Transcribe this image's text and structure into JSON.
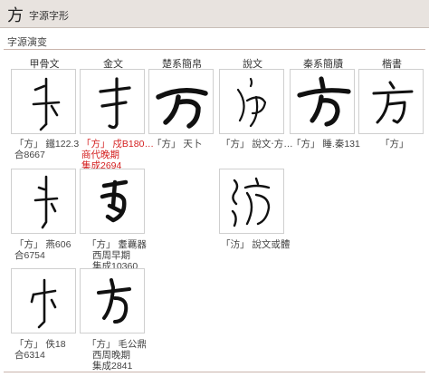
{
  "header": {
    "char": "方",
    "title": "字源字形"
  },
  "section": {
    "title": "字源演变"
  },
  "columns": [
    "甲骨文",
    "金文",
    "楚系簡帛",
    "說文",
    "秦系簡牘",
    "楷書"
  ],
  "cells": [
    {
      "id": "c1",
      "caption": [
        "「方」 鐵122.3",
        "合8667"
      ],
      "red": false
    },
    {
      "id": "c2",
      "caption": [
        "「方」 戍B180…",
        "商代晚期",
        "集成2694"
      ],
      "red": true
    },
    {
      "id": "c3",
      "caption": [
        "「方」 天卜"
      ],
      "red": false
    },
    {
      "id": "c4",
      "caption": [
        "「方」 說文‧方…"
      ],
      "red": false
    },
    {
      "id": "c5",
      "caption": [
        "「方」 睡.秦131"
      ],
      "red": false
    },
    {
      "id": "c6",
      "caption": [
        "「方」"
      ],
      "red": false
    },
    {
      "id": "c7",
      "caption": [
        "「方」 燕606",
        "合6754"
      ],
      "red": false
    },
    {
      "id": "c8",
      "caption": [
        "「方」 耋覊器",
        "西周早期",
        "集成10360"
      ],
      "red": false
    },
    {
      "id": "c9",
      "caption": [
        "「汸」 說文或體"
      ],
      "red": false
    },
    {
      "id": "c10",
      "caption": [
        "「方」 佚18",
        "合6314"
      ],
      "red": false
    },
    {
      "id": "c11",
      "caption": [
        "「方」 毛公鼎",
        "西周晚期",
        "集成2841"
      ],
      "red": false
    }
  ],
  "glyphs": {
    "c1": "oracle-bone-fang",
    "c2": "bronze-fang",
    "c3": "chu-slip-fang",
    "c4": "shuowen-fang",
    "c5": "qin-slip-fang",
    "c6": "kaishu-fang",
    "c7": "oracle-bone-fang-2",
    "c8": "bronze-fang-2",
    "c9": "shuowen-variant-fang",
    "c10": "oracle-bone-fang-3",
    "c11": "bronze-fang-3"
  }
}
